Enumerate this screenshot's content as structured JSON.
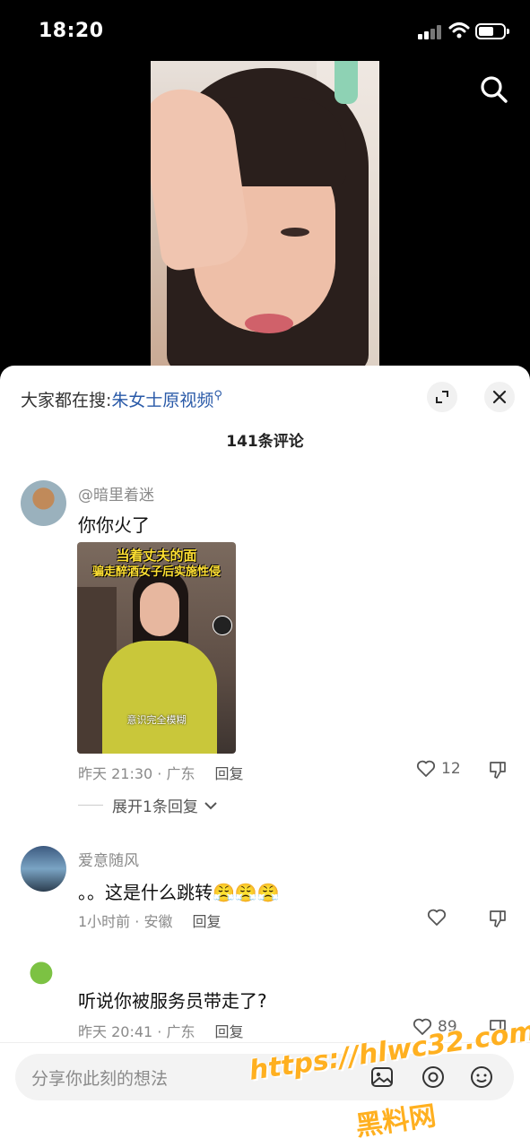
{
  "status_bar": {
    "time": "18:20"
  },
  "sheet": {
    "hot_search_prefix": "大家都在搜:",
    "hot_search_keyword": "朱女士原视频",
    "comment_count": "141条评论"
  },
  "comments": [
    {
      "username": "@暗里着迷",
      "text": "你你火了",
      "image": {
        "caption_line1": "当着丈夫的面",
        "caption_line2": "骗走醉酒女子后实施性侵",
        "subtitle": "意识完全模糊"
      },
      "time_location": "昨天 21:30 · 广东",
      "reply_label": "回复",
      "likes": "12"
    },
    {
      "username": "爱意随风",
      "text": "。。这是什么跳转😤😤😤",
      "time_location": "1小时前 · 安徽",
      "reply_label": "回复",
      "likes": ""
    },
    {
      "username": "",
      "text": "听说你被服务员带走了?",
      "time_location": "昨天 20:41 · 广东",
      "reply_label": "回复",
      "likes": "89"
    }
  ],
  "expand_replies": "展开1条回复",
  "input": {
    "placeholder": "分享你此刻的想法"
  },
  "watermark": {
    "line1": "https://hlwc32.com",
    "line2": "黑料网"
  },
  "colors": {
    "accent_link": "#2a5aa8",
    "watermark": "#ffb020"
  }
}
